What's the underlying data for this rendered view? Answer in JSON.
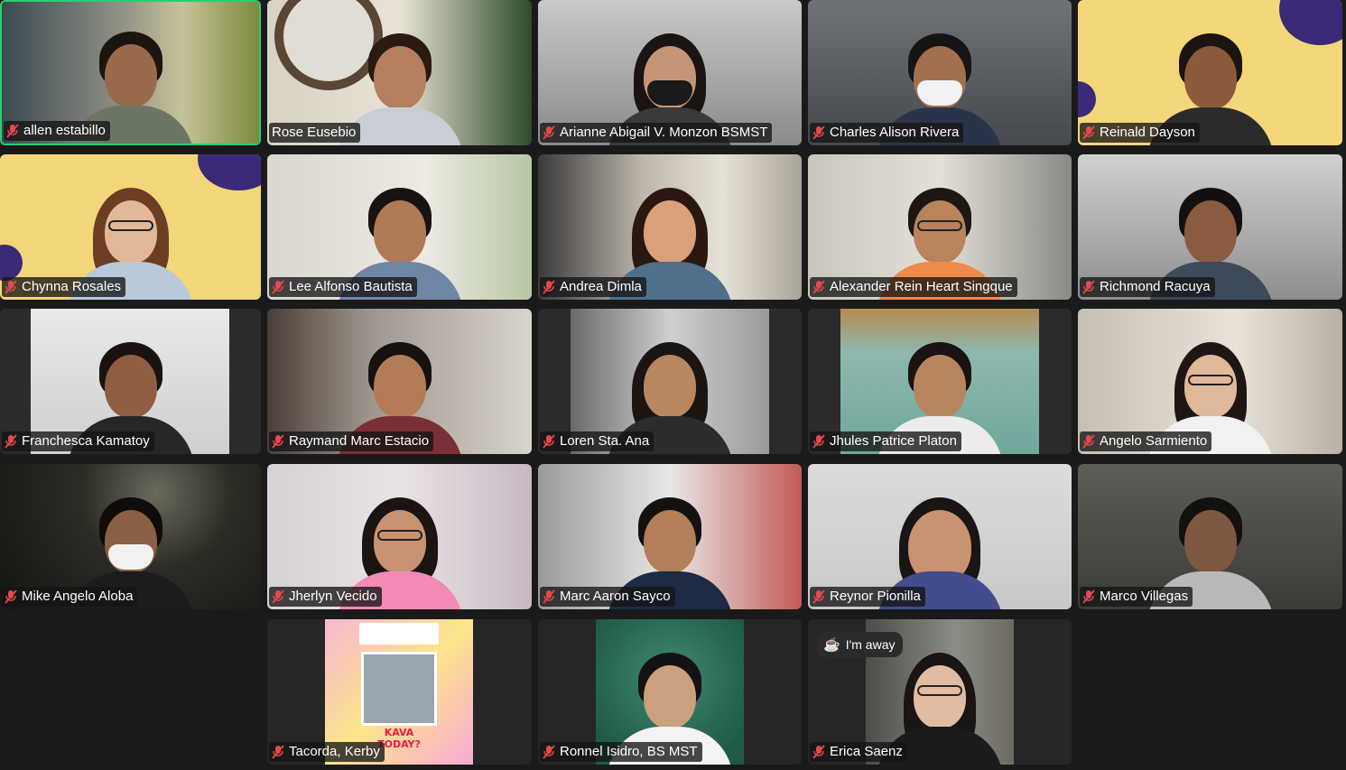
{
  "participants": [
    {
      "name": "allen estabillo",
      "muted": true,
      "active": true
    },
    {
      "name": "Rose Eusebio",
      "muted": false
    },
    {
      "name": "Arianne Abigail V. Monzon BSMST",
      "muted": true
    },
    {
      "name": "Charles Alison Rivera",
      "muted": true
    },
    {
      "name": "Reinald Dayson",
      "muted": true
    },
    {
      "name": "Chynna Rosales",
      "muted": true
    },
    {
      "name": "Lee Alfonso Bautista",
      "muted": true
    },
    {
      "name": "Andrea Dimla",
      "muted": true
    },
    {
      "name": "Alexander Rein Heart Singque",
      "muted": true
    },
    {
      "name": "Richmond Racuya",
      "muted": true
    },
    {
      "name": "Franchesca Kamatoy",
      "muted": true
    },
    {
      "name": "Raymand Marc Estacio",
      "muted": true
    },
    {
      "name": "Loren Sta. Ana",
      "muted": true
    },
    {
      "name": "Jhules Patrice Platon",
      "muted": true
    },
    {
      "name": "Angelo Sarmiento",
      "muted": true
    },
    {
      "name": "Mike Angelo Aloba",
      "muted": true
    },
    {
      "name": "Jherlyn Vecido",
      "muted": true
    },
    {
      "name": "Marc Aaron Sayco",
      "muted": true
    },
    {
      "name": "Reynor Pionilla",
      "muted": true
    },
    {
      "name": "Marco Villegas",
      "muted": true
    },
    {
      "name": "Tacorda, Kerby",
      "muted": true
    },
    {
      "name": "Ronnel Isidro, BS MST",
      "muted": true
    },
    {
      "name": "Erica Saenz",
      "muted": true,
      "status": "I'm away"
    }
  ],
  "poster": {
    "title": "KAVA TODAY?"
  },
  "colors": {
    "active_border": "#2ecc71",
    "mic_muted": "#e5484d",
    "label_bg": "#141414"
  }
}
